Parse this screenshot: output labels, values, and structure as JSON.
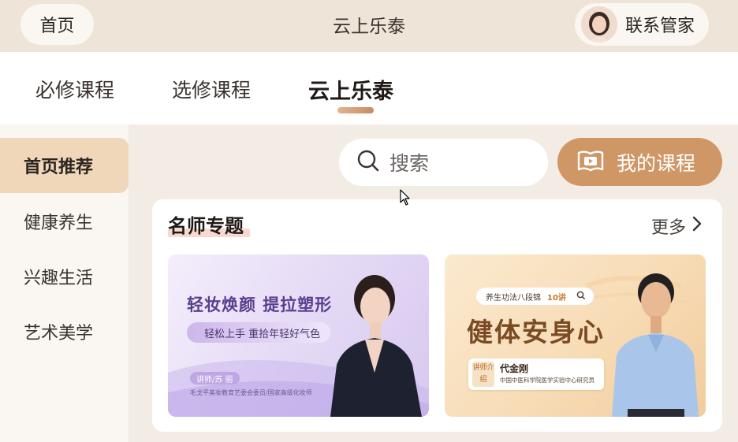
{
  "header": {
    "home_label": "首页",
    "title": "云上乐泰",
    "steward_label": "联系管家"
  },
  "tabs": [
    {
      "label": "必修课程",
      "active": false
    },
    {
      "label": "选修课程",
      "active": false
    },
    {
      "label": "云上乐泰",
      "active": true
    }
  ],
  "sidebar": {
    "items": [
      {
        "label": "首页推荐",
        "active": true
      },
      {
        "label": "健康养生",
        "active": false
      },
      {
        "label": "兴趣生活",
        "active": false
      },
      {
        "label": "艺术美学",
        "active": false
      }
    ]
  },
  "search": {
    "placeholder": "搜索",
    "icon": "search-icon"
  },
  "my_course": {
    "label": "我的课程",
    "icon": "book-video-icon"
  },
  "section": {
    "title": "名师专题",
    "more_label": "更多"
  },
  "courses": [
    {
      "headline": "轻妆焕颜 提拉塑形",
      "subtitle": "轻松上手 重拾年轻好气色",
      "teacher_tag": "讲师/苏 丽",
      "teacher_credit": "毛戈平美妆教育艺委会委员/国家高级化妆师"
    },
    {
      "chip_text": "养生功法八段锦",
      "chip_count": "10讲",
      "headline": "健体安身心",
      "tag": "讲师介绍",
      "teacher_name": "代金刚",
      "teacher_org": "中国中医科学院医学实验中心研究员"
    }
  ],
  "colors": {
    "accent": "#cf9666",
    "header_bg": "#efe4d8",
    "sidebar_active": "#f0d7b9"
  }
}
